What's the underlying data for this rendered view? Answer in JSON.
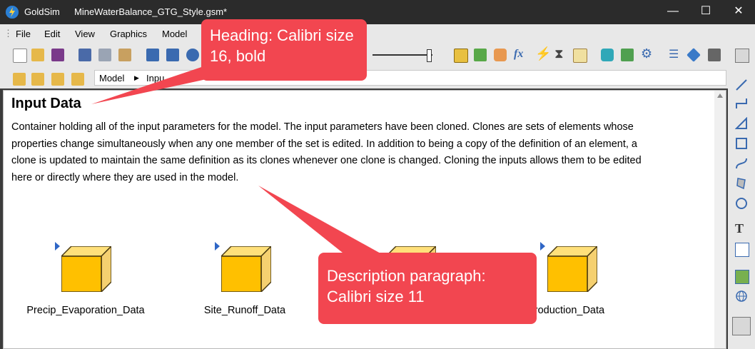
{
  "window": {
    "app_name": "GoldSim",
    "file_title": "MineWaterBalance_GTG_Style.gsm*",
    "minimize_glyph": "—",
    "maximize_glyph": "☐",
    "close_glyph": "✕"
  },
  "menu": {
    "items": [
      "File",
      "Edit",
      "View",
      "Graphics",
      "Model"
    ]
  },
  "breadcrumb": {
    "root": "Model",
    "separator": "▶",
    "current_partial": "Inpu"
  },
  "document": {
    "heading": "Input Data",
    "description": "Container holding all of the input parameters for the model. The input parameters have been cloned. Clones are sets of elements whose properties change simultaneously when any one member of the set is edited. In addition to being a copy of the definition of an element, a clone is updated to maintain the same definition as its clones whenever one clone is changed. Cloning the inputs allows them to be edited here or directly where they are used in the model."
  },
  "elements": [
    {
      "label": "Precip_Evaporation_Data"
    },
    {
      "label": "Site_Runoff_Data"
    },
    {
      "label": ""
    },
    {
      "label": "_Production_Data"
    }
  ],
  "callouts": {
    "heading_note": "Heading: Calibri size 16, bold",
    "description_note": "Description paragraph: Calibri size 11"
  },
  "colors": {
    "callout": "#f24650",
    "container_cube": "#ffc000",
    "marker": "#2f66c6",
    "titlebar": "#2b2b2b"
  },
  "icons": {
    "toolbar": [
      "new-file-icon",
      "open-folder-icon",
      "save-icon",
      "cut-icon",
      "copy-icon",
      "paste-icon",
      "hierarchy-icon",
      "comment-icon",
      "find-icon",
      "zoom-slider",
      "grid-icon",
      "export-icon",
      "container-icon",
      "function-icon",
      "event-icon",
      "timer-icon",
      "chart-icon",
      "reservoir-icon",
      "institution-icon",
      "gear-icon",
      "list-icon",
      "tag-icon",
      "units-icon",
      "browser-icon"
    ],
    "side": [
      "line-icon",
      "connector-icon",
      "triangle-icon",
      "rectangle-icon",
      "curve-icon",
      "polygon-icon",
      "ellipse-icon",
      "text-icon",
      "text-box-icon",
      "image-icon",
      "globe-icon",
      "graphics-pane-icon"
    ]
  }
}
